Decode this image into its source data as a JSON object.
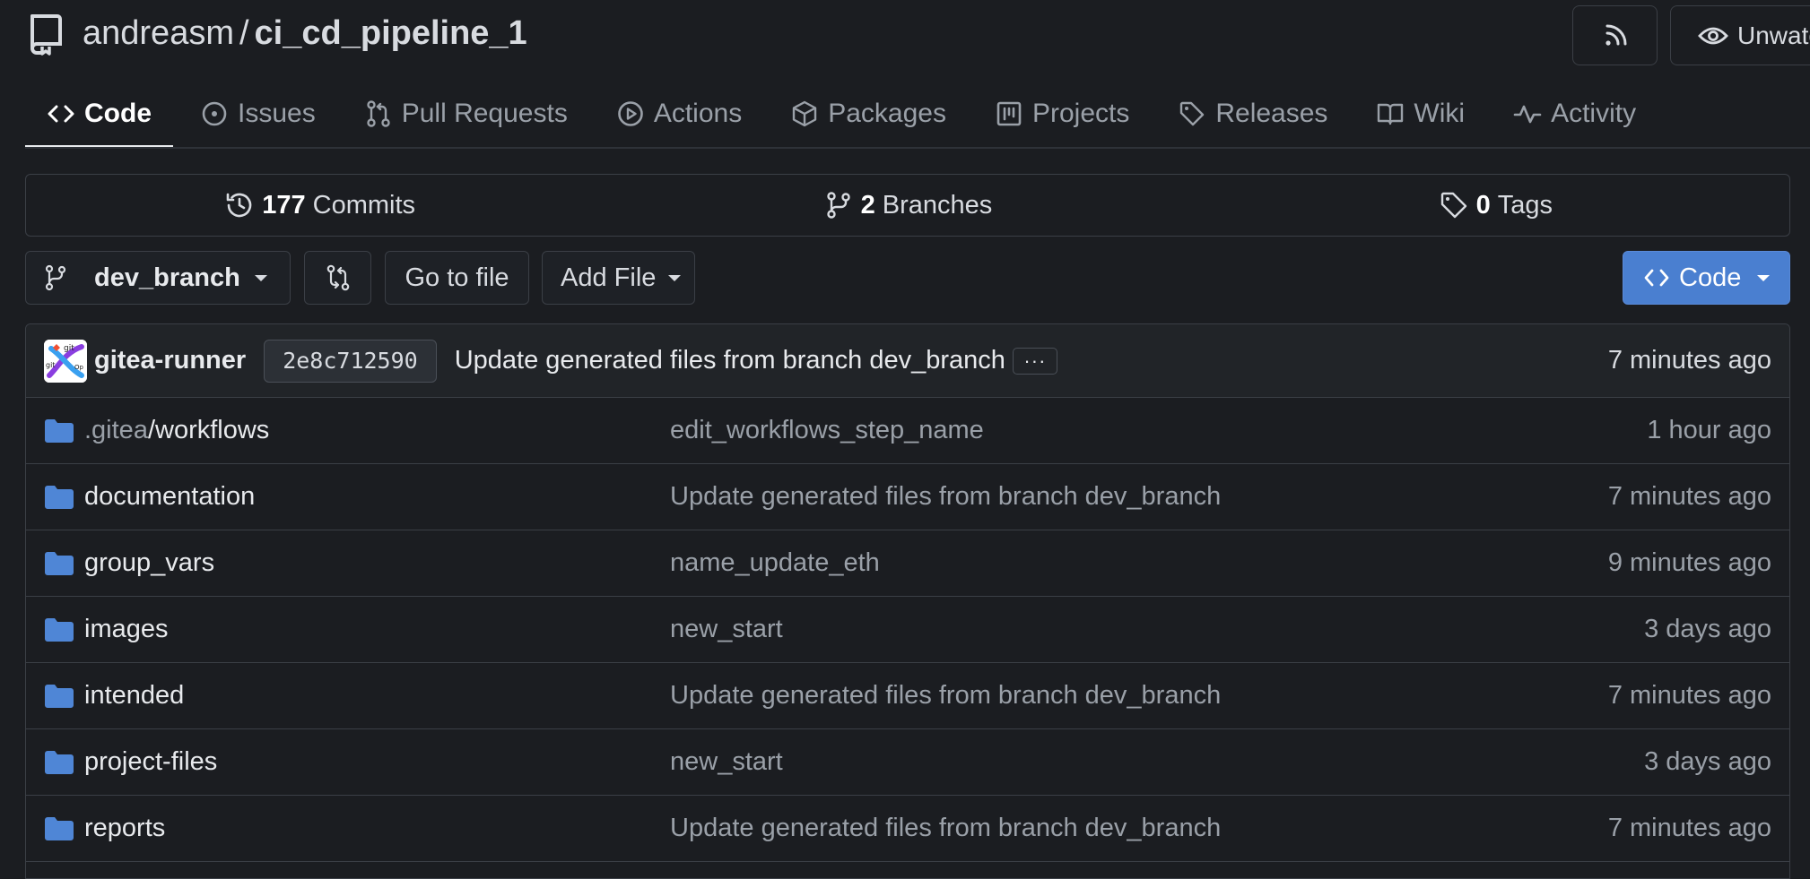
{
  "repo": {
    "owner": "andreasm",
    "separator": "/",
    "name": "ci_cd_pipeline_1",
    "icon": "repo-icon"
  },
  "header_buttons": {
    "rss_icon": "rss-icon",
    "watch_label": "Unwatch"
  },
  "tabs": [
    {
      "label": "Code",
      "icon": "code-icon",
      "active": true
    },
    {
      "label": "Issues",
      "icon": "issue-icon"
    },
    {
      "label": "Pull Requests",
      "icon": "pull-request-icon"
    },
    {
      "label": "Actions",
      "icon": "play-icon"
    },
    {
      "label": "Packages",
      "icon": "package-icon"
    },
    {
      "label": "Projects",
      "icon": "project-icon"
    },
    {
      "label": "Releases",
      "icon": "tag-icon"
    },
    {
      "label": "Wiki",
      "icon": "book-icon"
    },
    {
      "label": "Activity",
      "icon": "pulse-icon"
    }
  ],
  "stats": {
    "commits_count": "177",
    "commits_label": "Commits",
    "branches_count": "2",
    "branches_label": "Branches",
    "tags_count": "0",
    "tags_label": "Tags"
  },
  "toolbar": {
    "branch": "dev_branch",
    "go_to_file": "Go to file",
    "add_file": "Add File",
    "code": "Code"
  },
  "latest_commit": {
    "author": "gitea-runner",
    "sha": "2e8c712590",
    "message": "Update generated files from branch dev_branch",
    "ellipsis": "···",
    "time": "7 minutes ago"
  },
  "files": [
    {
      "name_prefix": ".gitea",
      "name": "/workflows",
      "commit": "edit_workflows_step_name",
      "time": "1 hour ago",
      "type": "folder"
    },
    {
      "name_prefix": "",
      "name": "documentation",
      "commit": "Update generated files from branch dev_branch",
      "time": "7 minutes ago",
      "type": "folder"
    },
    {
      "name_prefix": "",
      "name": "group_vars",
      "commit": "name_update_eth",
      "time": "9 minutes ago",
      "type": "folder"
    },
    {
      "name_prefix": "",
      "name": "images",
      "commit": "new_start",
      "time": "3 days ago",
      "type": "folder"
    },
    {
      "name_prefix": "",
      "name": "intended",
      "commit": "Update generated files from branch dev_branch",
      "time": "7 minutes ago",
      "type": "folder"
    },
    {
      "name_prefix": "",
      "name": "project-files",
      "commit": "new_start",
      "time": "3 days ago",
      "type": "folder"
    },
    {
      "name_prefix": "",
      "name": "reports",
      "commit": "Update generated files from branch dev_branch",
      "time": "7 minutes ago",
      "type": "folder"
    }
  ],
  "colors": {
    "background": "#1b1d21",
    "folder": "#4f86d6",
    "code_button": "#4a7fd0"
  }
}
